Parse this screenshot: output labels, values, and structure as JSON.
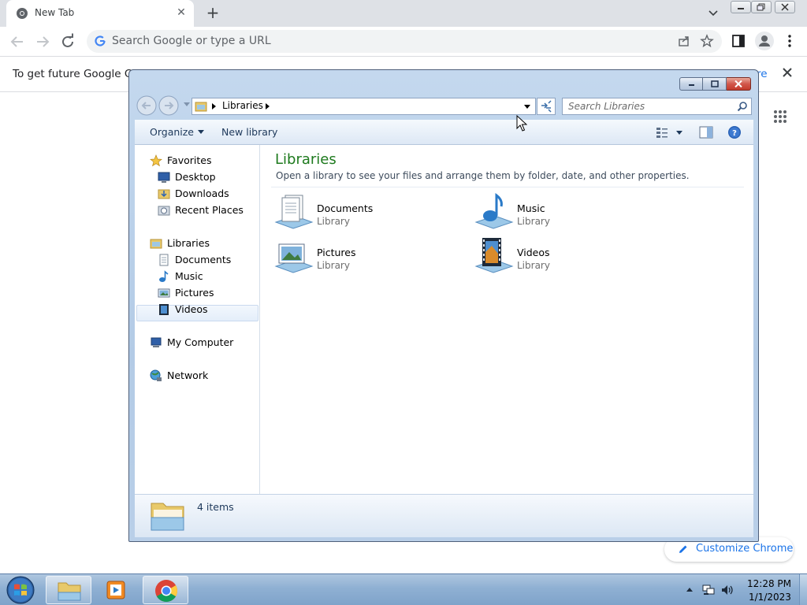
{
  "chrome": {
    "tab_title": "New Tab",
    "omnibox_placeholder": "Search Google or type a URL",
    "info_bar_text": "To get future Google Chro",
    "info_bar_link": "re",
    "customize_label": "Customize Chrome"
  },
  "explorer": {
    "breadcrumb": "Libraries",
    "search_placeholder": "Search Libraries",
    "toolbar": {
      "organize": "Organize",
      "new_library": "New library"
    },
    "nav": {
      "favorites": "Favorites",
      "desktop": "Desktop",
      "downloads": "Downloads",
      "recent_places": "Recent Places",
      "libraries": "Libraries",
      "documents": "Documents",
      "music": "Music",
      "pictures": "Pictures",
      "videos": "Videos",
      "my_computer": "My Computer",
      "network": "Network"
    },
    "content": {
      "title": "Libraries",
      "description": "Open a library to see your files and arrange them by folder, date, and other properties.",
      "tiles": [
        {
          "name": "Documents",
          "type": "Library"
        },
        {
          "name": "Music",
          "type": "Library"
        },
        {
          "name": "Pictures",
          "type": "Library"
        },
        {
          "name": "Videos",
          "type": "Library"
        }
      ]
    },
    "status": "4 items"
  },
  "taskbar": {
    "time": "12:28 PM",
    "date": "1/1/2023"
  },
  "colors": {
    "accent_blue": "#1a73e8",
    "library_title_green": "#1e7a1e",
    "taskbar_blue": "#8fb0d3"
  }
}
